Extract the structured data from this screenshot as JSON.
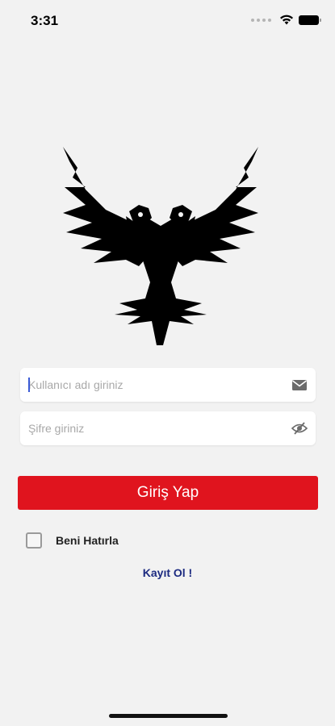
{
  "status_bar": {
    "time": "3:31",
    "icons": [
      "dots-icon",
      "wifi-icon",
      "battery-icon"
    ]
  },
  "logo": {
    "icon": "double-headed-eagle-logo"
  },
  "login_form": {
    "username_placeholder": "Kullanıcı adı giriniz",
    "username_value": "",
    "username_icon": "envelope-icon",
    "password_placeholder": "Şifre giriniz",
    "password_value": "",
    "password_icon": "eye-slash-icon",
    "submit_label": "Giriş Yap",
    "remember_label": "Beni Hatırla",
    "remember_checked": false,
    "register_label": "Kayıt Ol !"
  },
  "colors": {
    "background": "#f2f2f2",
    "primary_button": "#e0141e",
    "link": "#1c2a80"
  }
}
